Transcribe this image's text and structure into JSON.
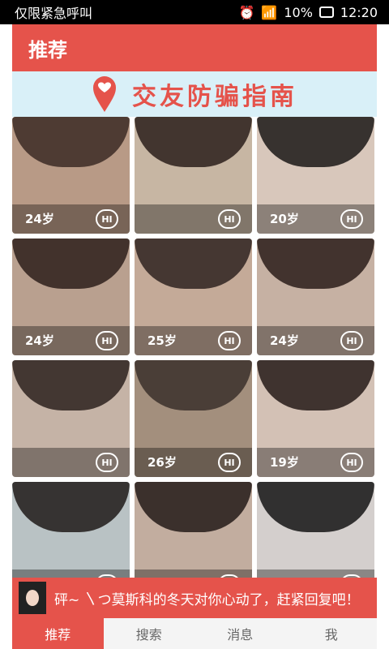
{
  "status_bar": {
    "left_text": "仅限紧急呼叫",
    "battery": "10%",
    "time": "12:20",
    "icons": [
      "alarm-icon",
      "wifi-icon",
      "signal-icon",
      "battery-icon"
    ]
  },
  "app_bar": {
    "title": "推荐"
  },
  "banner": {
    "text": "交友防骗指南",
    "icon": "location-pin-icon"
  },
  "grid": {
    "tiles": [
      {
        "age": "24岁",
        "hi": "HI",
        "bg": "#b89a86",
        "hair": "#3b2a24"
      },
      {
        "age": "",
        "hi": "HI",
        "bg": "#c7b6a3",
        "hair": "#2a1f1b"
      },
      {
        "age": "20岁",
        "hi": "HI",
        "bg": "#d8c7bb",
        "hair": "#1b1716"
      },
      {
        "age": "24岁",
        "hi": "HI",
        "bg": "#b9a08f",
        "hair": "#2d1f1b"
      },
      {
        "age": "25岁",
        "hi": "HI",
        "bg": "#c4aa98",
        "hair": "#2f2320"
      },
      {
        "age": "24岁",
        "hi": "HI",
        "bg": "#c6b1a3",
        "hair": "#2a1d1a"
      },
      {
        "age": "",
        "hi": "HI",
        "bg": "#c5b3a6",
        "hair": "#2c211d"
      },
      {
        "age": "26岁",
        "hi": "HI",
        "bg": "#a38f7d",
        "hair": "#3b302a"
      },
      {
        "age": "19岁",
        "hi": "HI",
        "bg": "#d3c1b5",
        "hair": "#241a17"
      },
      {
        "age": "",
        "hi": "HI",
        "bg": "#b9c2c4",
        "hair": "#1e1a19"
      },
      {
        "age": "",
        "hi": "HI",
        "bg": "#c2ad9f",
        "hair": "#231a17"
      },
      {
        "age": "",
        "hi": "HI",
        "bg": "#d4cfcd",
        "hair": "#141414"
      }
    ]
  },
  "toast": {
    "text": "砰~ 〵つ莫斯科的冬天对你心动了，赶紧回复吧！"
  },
  "tabs": [
    {
      "label": "推荐",
      "active": true
    },
    {
      "label": "搜索",
      "active": false
    },
    {
      "label": "消息",
      "active": false
    },
    {
      "label": "我",
      "active": false
    }
  ]
}
